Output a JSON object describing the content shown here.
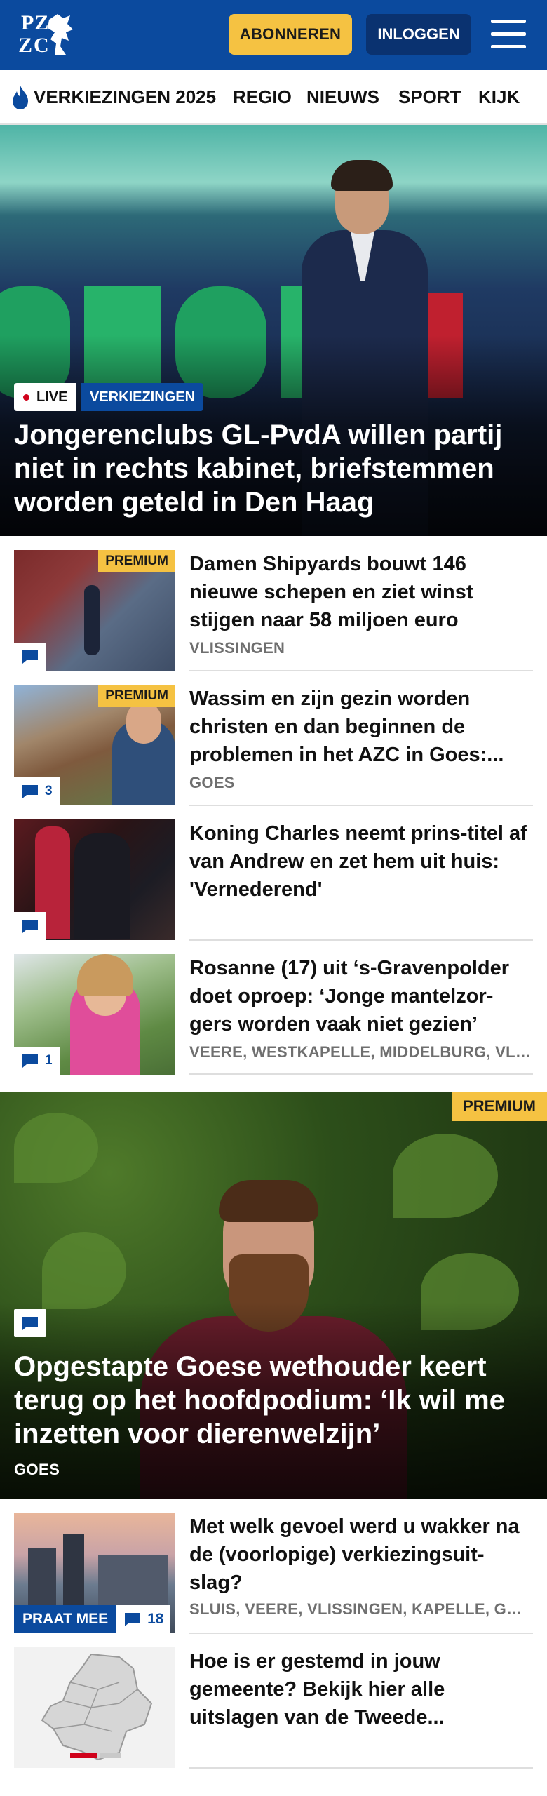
{
  "header": {
    "logo_line1": "PZ",
    "logo_line2": "ZC",
    "subscribe_label": "ABONNEREN",
    "login_label": "INLOGGEN"
  },
  "nav": {
    "items": [
      {
        "label": "VERKIEZINGEN 2025"
      },
      {
        "label": "REGIO"
      },
      {
        "label": "NIEUWS"
      },
      {
        "label": "SPORT"
      },
      {
        "label": "KIJK"
      }
    ]
  },
  "hero": {
    "badge_live": "LIVE",
    "badge_topic": "VERKIEZINGEN",
    "title": "Jongerenclubs GL-PvdA willen partij niet in rechts kabinet, briefstemmen worden geteld in Den Haag"
  },
  "articles": [
    {
      "premium": "PREMIUM",
      "title": "Damen Shipyards bouwt 146 nieuwe schepen en ziet winst stijgen naar 58 miljoen euro",
      "location": "VLISSINGEN",
      "comments": ""
    },
    {
      "premium": "PREMIUM",
      "title": "Wassim en zijn gezin worden christen en dan beginnen de problemen in het AZC in Goes:...",
      "location": "GOES",
      "comments": "3"
    },
    {
      "premium": "",
      "title": "Koning Charles neemt prins-titel af van Andrew en zet hem uit huis: 'Vernederend'",
      "location": "",
      "comments": ""
    },
    {
      "premium": "",
      "title": "Rosanne (17) uit ‘s-Gravenpolder doet oproep: ‘Jonge mantelzor-gers worden vaak niet gezien’",
      "location": "VEERE, WESTKAPELLE, MIDDELBURG, VLISSINGEN",
      "comments": "1"
    }
  ],
  "feature": {
    "premium": "PREMIUM",
    "title": "Opgestapte Goese wethouder keert terug op het hoofdpodium: ‘Ik wil me inzetten voor dierenwelzijn’",
    "location": "GOES"
  },
  "articles2": [
    {
      "title": "Met welk gevoel werd u wakker na de (voorlopige) verkiezingsuit-slag?",
      "location": "SLUIS, VEERE, VLISSINGEN, KAPELLE, GOES",
      "praat_label": "PRAAT MEE",
      "comments": "18"
    },
    {
      "title": "Hoe is er gestemd in jouw gemeente? Bekijk hier alle uitslagen van de Tweede...",
      "location": ""
    }
  ],
  "colors": {
    "brand_blue": "#0b4a9e",
    "premium_yellow": "#f5c242",
    "live_red": "#d0021b"
  }
}
